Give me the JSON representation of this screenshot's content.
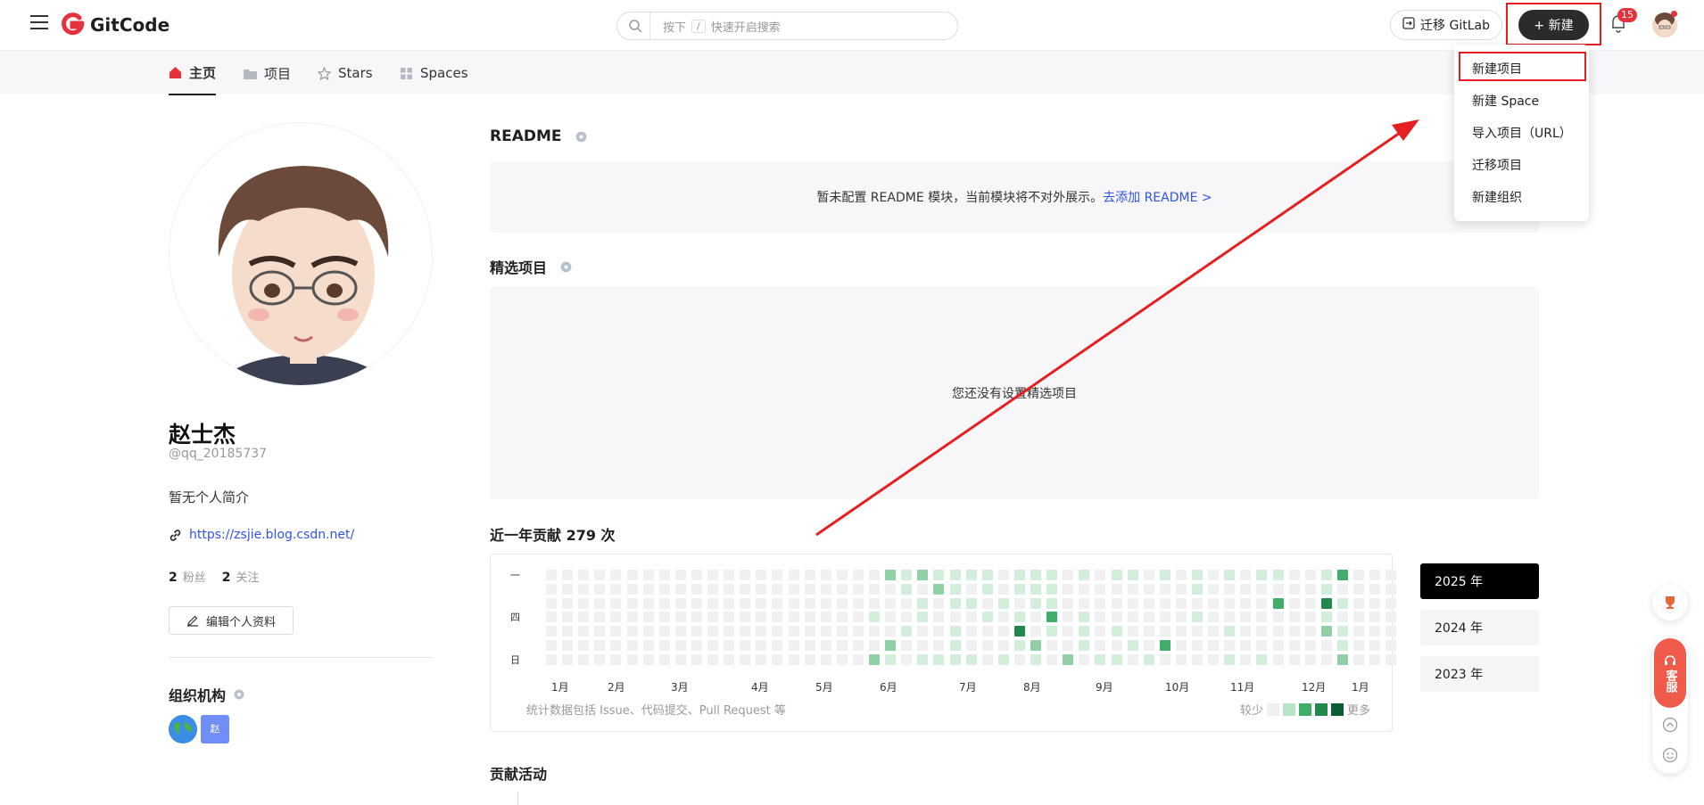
{
  "header": {
    "logo_text": "GitCode",
    "search_prefix": "按下",
    "search_key": "/",
    "search_placeholder": "快速开启搜索",
    "migrate_label": "迁移 GitLab",
    "new_label": "+ 新建",
    "notification_count": "15"
  },
  "tabs": [
    {
      "label": "主页",
      "icon": "home-icon",
      "active": true
    },
    {
      "label": "项目",
      "icon": "folder-icon",
      "active": false
    },
    {
      "label": "Stars",
      "icon": "star-icon",
      "active": false
    },
    {
      "label": "Spaces",
      "icon": "grid-icon",
      "active": false
    }
  ],
  "dropdown": {
    "items": [
      "新建项目",
      "新建 Space",
      "导入项目（URL）",
      "迁移项目",
      "新建组织"
    ]
  },
  "profile": {
    "name": "赵士杰",
    "username": "@qq_20185737",
    "bio": "暂无个人简介",
    "link": "https://zsjie.blog.csdn.net/",
    "followers_count": "2",
    "followers_label": "粉丝",
    "following_count": "2",
    "following_label": "关注",
    "edit_label": "编辑个人资料",
    "org_title": "组织机构",
    "org_badge": "赵"
  },
  "readme": {
    "title": "README",
    "notice": "暂未配置 README 模块，当前模块将不对外展示。",
    "link": "去添加 README >"
  },
  "featured": {
    "title": "精选项目",
    "empty": "您还没有设置精选项目"
  },
  "contrib": {
    "title": "近一年贡献 279 次",
    "weekdays": [
      "一",
      "四",
      "日"
    ],
    "months": [
      "1月",
      "2月",
      "3月",
      "4月",
      "5月",
      "6月",
      "7月",
      "8月",
      "9月",
      "10月",
      "11月",
      "12月",
      "1月"
    ],
    "footnote": "统计数据包括 Issue、代码提交、Pull Request 等",
    "legend_less": "较少",
    "legend_more": "更多",
    "years": [
      "2025 年",
      "2024 年",
      "2023 年"
    ],
    "active_year": "2025 年"
  },
  "activity": {
    "title": "贡献活动"
  },
  "floating": {
    "service_label": "客服"
  },
  "colors": {
    "brand": "#e6323c",
    "annotation": "#e51f1f",
    "link": "#2f54eb",
    "green_levels": [
      "#f0f0f0",
      "#d4eedc",
      "#8fd1a4",
      "#3fae6a",
      "#1f8a4c",
      "#0e5c31"
    ]
  }
}
